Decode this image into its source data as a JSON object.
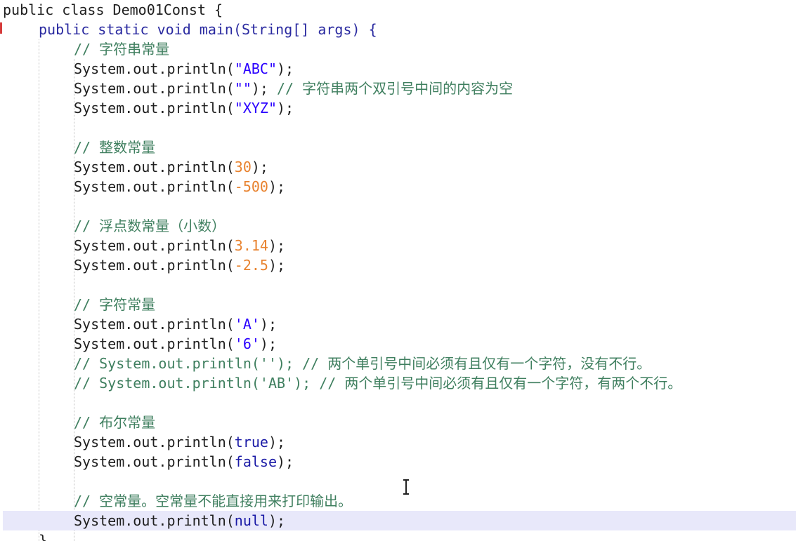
{
  "editor": {
    "current_line_index": 26,
    "lines": [
      {
        "tokens": [
          {
            "t": "public class Demo01Const {",
            "c": "plain"
          }
        ]
      },
      {
        "tokens": [
          {
            "t": "public static void main(String[] args) {",
            "c": "kw-blue"
          }
        ]
      },
      {
        "tokens": [
          {
            "t": "// 字符串常量",
            "c": "cmt"
          }
        ]
      },
      {
        "tokens": [
          {
            "t": "System.out.println(",
            "c": "plain"
          },
          {
            "t": "\"ABC\"",
            "c": "str"
          },
          {
            "t": ");",
            "c": "plain"
          }
        ]
      },
      {
        "tokens": [
          {
            "t": "System.out.println(",
            "c": "plain"
          },
          {
            "t": "\"\"",
            "c": "str"
          },
          {
            "t": "); ",
            "c": "plain"
          },
          {
            "t": "// 字符串两个双引号中间的内容为空",
            "c": "cmt"
          }
        ]
      },
      {
        "tokens": [
          {
            "t": "System.out.println(",
            "c": "plain"
          },
          {
            "t": "\"XYZ\"",
            "c": "str"
          },
          {
            "t": ");",
            "c": "plain"
          }
        ]
      },
      {
        "tokens": []
      },
      {
        "tokens": [
          {
            "t": "// 整数常量",
            "c": "cmt"
          }
        ]
      },
      {
        "tokens": [
          {
            "t": "System.out.println(",
            "c": "plain"
          },
          {
            "t": "30",
            "c": "num"
          },
          {
            "t": ");",
            "c": "plain"
          }
        ]
      },
      {
        "tokens": [
          {
            "t": "System.out.println(",
            "c": "plain"
          },
          {
            "t": "-500",
            "c": "num"
          },
          {
            "t": ");",
            "c": "plain"
          }
        ]
      },
      {
        "tokens": []
      },
      {
        "tokens": [
          {
            "t": "// 浮点数常量（小数）",
            "c": "cmt"
          }
        ]
      },
      {
        "tokens": [
          {
            "t": "System.out.println(",
            "c": "plain"
          },
          {
            "t": "3.14",
            "c": "num"
          },
          {
            "t": ");",
            "c": "plain"
          }
        ]
      },
      {
        "tokens": [
          {
            "t": "System.out.println(",
            "c": "plain"
          },
          {
            "t": "-2.5",
            "c": "num"
          },
          {
            "t": ");",
            "c": "plain"
          }
        ]
      },
      {
        "tokens": []
      },
      {
        "tokens": [
          {
            "t": "// 字符常量",
            "c": "cmt"
          }
        ]
      },
      {
        "tokens": [
          {
            "t": "System.out.println(",
            "c": "plain"
          },
          {
            "t": "'A'",
            "c": "str"
          },
          {
            "t": ");",
            "c": "plain"
          }
        ]
      },
      {
        "tokens": [
          {
            "t": "System.out.println(",
            "c": "plain"
          },
          {
            "t": "'6'",
            "c": "str"
          },
          {
            "t": ");",
            "c": "plain"
          }
        ]
      },
      {
        "tokens": [
          {
            "t": "// System.out.println(''); // 两个单引号中间必须有且仅有一个字符，没有不行。",
            "c": "cmt"
          }
        ]
      },
      {
        "tokens": [
          {
            "t": "// System.out.println('AB'); // 两个单引号中间必须有且仅有一个字符，有两个不行。",
            "c": "cmt"
          }
        ]
      },
      {
        "tokens": []
      },
      {
        "tokens": [
          {
            "t": "// 布尔常量",
            "c": "cmt"
          }
        ]
      },
      {
        "tokens": [
          {
            "t": "System.out.println(",
            "c": "plain"
          },
          {
            "t": "true",
            "c": "lit"
          },
          {
            "t": ");",
            "c": "plain"
          }
        ]
      },
      {
        "tokens": [
          {
            "t": "System.out.println(",
            "c": "plain"
          },
          {
            "t": "false",
            "c": "lit"
          },
          {
            "t": ");",
            "c": "plain"
          }
        ]
      },
      {
        "tokens": []
      },
      {
        "tokens": [
          {
            "t": "// 空常量。空常量不能直接用来打印输出。",
            "c": "cmt"
          }
        ]
      },
      {
        "tokens": [
          {
            "t": "System.out.println(",
            "c": "plain"
          },
          {
            "t": "null",
            "c": "lit"
          },
          {
            "t": ");",
            "c": "plain"
          }
        ]
      },
      {
        "tokens": [
          {
            "t": "}",
            "c": "plain"
          }
        ]
      }
    ]
  },
  "colors": {
    "comment": "#3f7f5f",
    "string": "#2a00ff",
    "number": "#e8822e",
    "literal": "#1a1aa6",
    "current_line": "#e8e8fa",
    "error_marker": "#d63b3b"
  }
}
